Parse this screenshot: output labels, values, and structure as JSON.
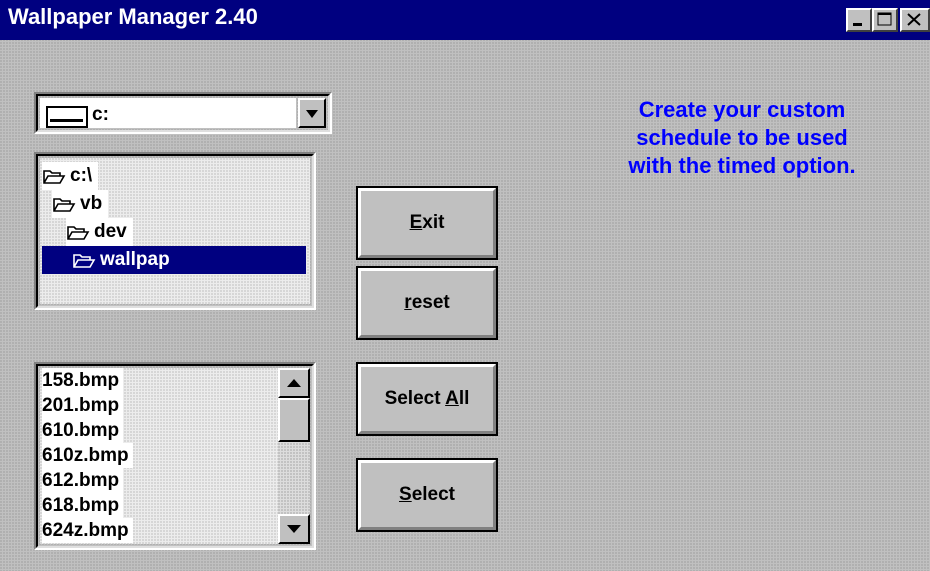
{
  "window": {
    "title": "Wallpaper Manager 2.40"
  },
  "drive": {
    "value": "c:"
  },
  "directories": [
    {
      "label": "c:\\",
      "selected": false
    },
    {
      "label": "vb",
      "selected": false
    },
    {
      "label": "dev",
      "selected": false
    },
    {
      "label": "wallpap",
      "selected": true
    }
  ],
  "files": [
    "158.bmp",
    "201.bmp",
    "610.bmp",
    "610z.bmp",
    "612.bmp",
    "618.bmp",
    "624z.bmp"
  ],
  "buttons": {
    "exit": {
      "pre": "",
      "key": "E",
      "post": "xit"
    },
    "reset": {
      "pre": "",
      "key": "r",
      "post": "eset"
    },
    "select_all": {
      "pre": "Select ",
      "key": "A",
      "post": "ll"
    },
    "select": {
      "pre": "",
      "key": "S",
      "post": "elect"
    }
  },
  "info": {
    "lines": [
      "Create your custom",
      "schedule to be used",
      "with the timed option."
    ]
  },
  "colors": {
    "titlebar": "#000080",
    "selection": "#000080",
    "info_text": "#0000ff",
    "face": "#c0c0c0"
  }
}
